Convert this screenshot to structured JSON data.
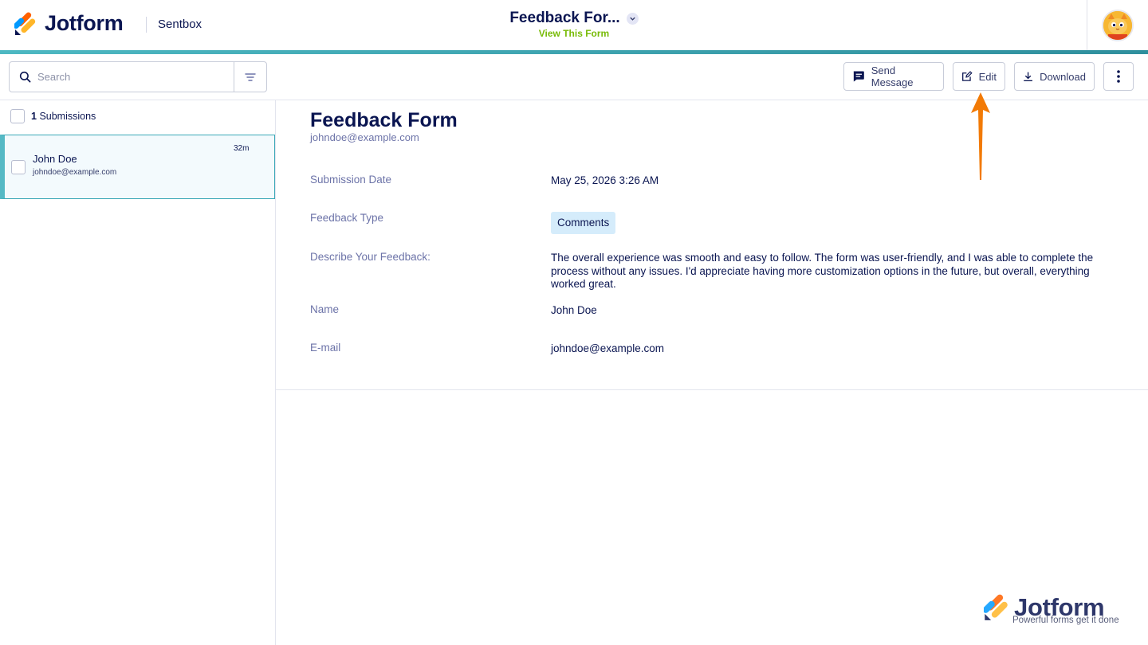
{
  "header": {
    "brand": "Jotform",
    "section": "Sentbox",
    "form_title": "Feedback For...",
    "view_form_link": "View This Form"
  },
  "toolbar": {
    "search_placeholder": "Search",
    "send_message_label": "Send Message",
    "edit_label": "Edit",
    "download_label": "Download"
  },
  "submissions": {
    "count": "1",
    "count_label": "Submissions",
    "items": [
      {
        "name": "John Doe",
        "email": "johndoe@example.com",
        "time": "32m"
      }
    ]
  },
  "detail": {
    "title": "Feedback Form",
    "email": "johndoe@example.com",
    "fields": [
      {
        "label": "Submission Date",
        "value": "May 25, 2026 3:26 AM"
      },
      {
        "label": "Feedback Type",
        "value": "Comments"
      },
      {
        "label": "Describe Your Feedback:",
        "value": "The overall experience was smooth and easy to follow. The form was user-friendly, and I was able to complete the process without any issues. I'd appreciate having more customization options in the future, but overall, everything worked great."
      },
      {
        "label": "Name",
        "value": "John Doe"
      },
      {
        "label": "E-mail",
        "value": "johndoe@example.com"
      }
    ]
  },
  "watermark": {
    "brand": "Jotform",
    "tagline": "Powerful forms get it done"
  },
  "colors": {
    "navy": "#0a1551",
    "accent_teal": "#3aa8b7",
    "link_green": "#78bb07",
    "tag_bg": "#d5ecfb",
    "arrow_orange": "#f27a05"
  },
  "icons": [
    "jotform-logo-icon",
    "chevron-down-icon",
    "avatar-cat-icon",
    "search-icon",
    "filter-icon",
    "message-icon",
    "edit-icon",
    "download-icon",
    "more-vertical-icon",
    "arrow-up-icon"
  ]
}
